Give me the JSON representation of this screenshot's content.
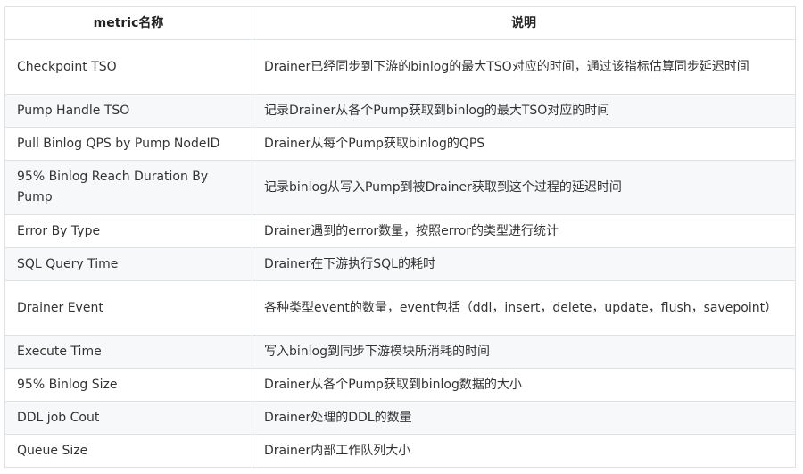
{
  "table": {
    "headers": [
      "metric名称",
      "说明"
    ],
    "rows": [
      {
        "metric": "Checkpoint TSO",
        "description": "Drainer已经同步到下游的binlog的最大TSO对应的时间，通过该指标估算同步延迟时间"
      },
      {
        "metric": "Pump Handle TSO",
        "description": "记录Drainer从各个Pump获取到binlog的最大TSO对应的时间"
      },
      {
        "metric": "Pull Binlog QPS by Pump NodeID",
        "description": "Drainer从每个Pump获取binlog的QPS"
      },
      {
        "metric": "95% Binlog Reach Duration By Pump",
        "description": "记录binlog从写入Pump到被Drainer获取到这个过程的延迟时间"
      },
      {
        "metric": "Error By Type",
        "description": "Drainer遇到的error数量，按照error的类型进行统计"
      },
      {
        "metric": "SQL Query Time",
        "description": "Drainer在下游执行SQL的耗时"
      },
      {
        "metric": "Drainer Event",
        "description": "各种类型event的数量，event包括（ddl，insert，delete，update，flush，savepoint）"
      },
      {
        "metric": "Execute Time",
        "description": "写入binlog到同步下游模块所消耗的时间"
      },
      {
        "metric": "95% Binlog Size",
        "description": "Drainer从各个Pump获取到binlog数据的大小"
      },
      {
        "metric": "DDL job Cout",
        "description": "Drainer处理的DDL的数量"
      },
      {
        "metric": "Queue Size",
        "description": "Drainer内部工作队列大小"
      }
    ]
  }
}
